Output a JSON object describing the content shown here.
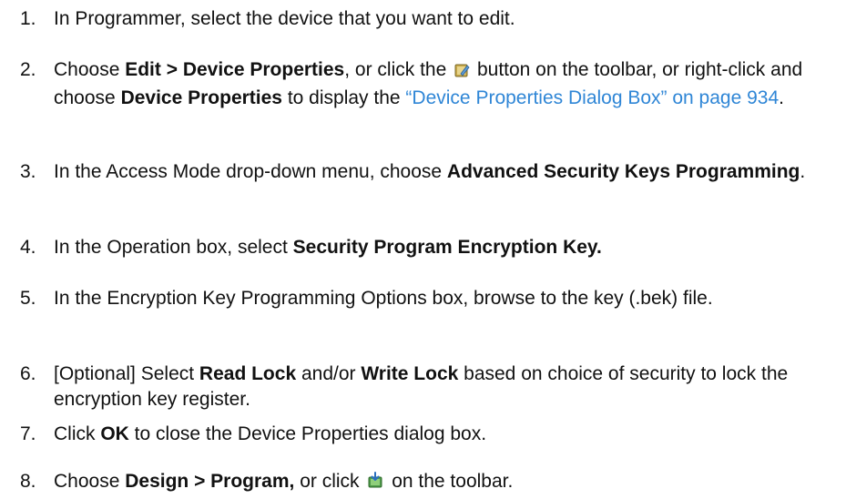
{
  "steps": [
    {
      "number": "1.",
      "text": "In Programmer, select the device that you want to edit."
    },
    {
      "number": "2.",
      "prefix": "Choose ",
      "bold1": "Edit > Device Properties",
      "mid1": ", or click the ",
      "icon": "device-properties-icon",
      "mid2": " button on the toolbar, or right-click and choose ",
      "bold2": "Device Properties",
      "mid3": " to display the ",
      "link": "“Device Properties Dialog Box” on page 934",
      "suffix": "."
    },
    {
      "number": "3.",
      "prefix": "In the Access Mode drop-down menu, choose ",
      "bold": "Advanced Security Keys Programming",
      "suffix": "."
    },
    {
      "number": "4.",
      "prefix": "In the Operation box, select ",
      "bold": "Security Program Encryption Key."
    },
    {
      "number": "5.",
      "text": "In the Encryption Key Programming Options box, browse to the key (.bek) file."
    },
    {
      "number": "6.",
      "prefix": "[Optional] Select ",
      "bold1": "Read Lock",
      "mid": " and/or ",
      "bold2": "Write Lock",
      "suffix": " based on choice of security to lock the encryption key register."
    },
    {
      "number": "7.",
      "prefix": "Click ",
      "bold": "OK",
      "suffix": " to close the Device Properties dialog box."
    },
    {
      "number": "8.",
      "prefix": "Choose ",
      "bold": "Design > Program,",
      "mid": " or click ",
      "icon": "program-icon",
      "suffix": " on the toolbar."
    }
  ],
  "colors": {
    "text": "#111111",
    "link": "#2f86d6"
  }
}
